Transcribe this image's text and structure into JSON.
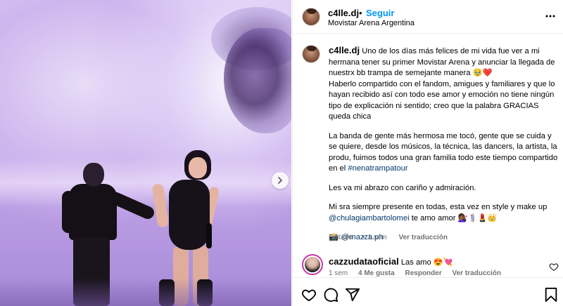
{
  "post": {
    "username": "c4lle.dj",
    "separator": "•",
    "follow_label": "Seguir",
    "location": "Movistar Arena Argentina",
    "more_icon": "more-options-icon"
  },
  "caption": {
    "username": "c4lle.dj",
    "paragraph1": "Uno de los días más felices de mi vida fue ver a mi hermana tener su primer Movistar Arena y anunciar la llegada de nuestrx bb trampa de semejante manera 🥹❤️",
    "paragraph2": "Haberlo compartido con el fandom, amigues y familiares y que lo hayan recibido así con todo ese amor y emoción no tiene ningún tipo de explicación ni sentido; creo que la palabra GRACIAS queda chica",
    "paragraph3": "La banda de gente más hermosa me tocó, gente que se cuida y se quiere, desde los músicos, la técnica, las dancers, la artista, la produ, fuimos todos una gran familia todo este tiempo compartido en el ",
    "hashtag": "#nenatrampatour",
    "paragraph4": "Les va mi abrazo con cariño y admiración.",
    "paragraph5": "Mi sra siempre presente en todas, esta vez en style y make up ",
    "mention": "@chulagiambartolomei",
    "paragraph5_end": " te amo amor 💇🏾‍♀️💈💄👑",
    "credit_emoji": "📸",
    "credit_mention": "@mazza.ph",
    "edited": "Editado",
    "dot": "•",
    "age": "1 sem",
    "translate": "Ver traducción"
  },
  "comment": {
    "username": "cazzudataoficial",
    "text": "Las amo 😍💘",
    "age": "1 sem",
    "likes": "4 Me gusta",
    "reply": "Responder",
    "translate": "Ver traducción"
  },
  "icons": {
    "like": "heart-icon",
    "comment": "comment-icon",
    "share": "share-icon",
    "save": "bookmark-icon",
    "next": "chevron-right-icon"
  }
}
